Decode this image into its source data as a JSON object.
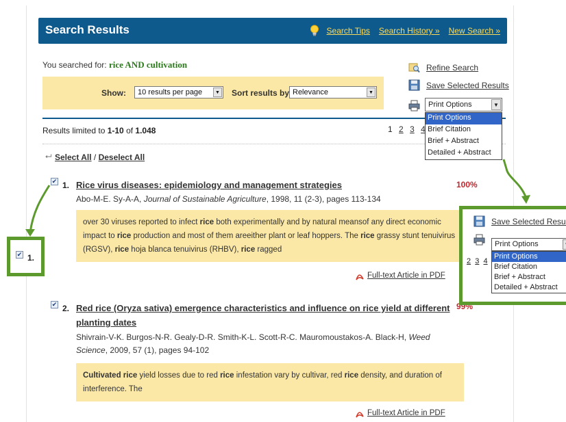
{
  "header": {
    "title": "Search Results",
    "links": [
      "Search Tips",
      "Search History »",
      "New Search »"
    ]
  },
  "query": {
    "prefix": "You searched for:",
    "term": "rice AND cultivation"
  },
  "controls": {
    "show_label": "Show:",
    "per_page_value": "10 results per page",
    "sort_label": "Sort results by:",
    "sort_value": "Relevance"
  },
  "side_actions": {
    "refine": "Refine Search",
    "save": "Save Selected Results",
    "print_value": "Print Options"
  },
  "print_options": [
    "Print Options",
    "Brief Citation",
    "Brief + Abstract",
    "Detailed + Abstract"
  ],
  "summary": {
    "prefix": "Results limited to ",
    "range": "1-10",
    "of": " of ",
    "total": "1.048"
  },
  "pager": [
    "1",
    "2",
    "3",
    "4"
  ],
  "select": {
    "select_all": "Select All",
    "sep": " / ",
    "deselect_all": "Deselect All"
  },
  "results": [
    {
      "num": "1.",
      "title": "Rice virus diseases: epidemiology and management strategies",
      "authors": "Abo-M-E. Sy-A-A, ",
      "journal": "Journal of Sustainable Agriculture",
      "citation": ", 1998, 11 (2-3), pages 113-134",
      "relevance": "100%",
      "snippet_html": "over 30 viruses reported to infect <b>rice</b> both experimentally and by natural meansof any direct economic impact to <b>rice</b> production and most of them areeither plant or leaf hoppers. The <b>rice</b> grassy stunt tenuivirus (RGSV), <b>rice</b> hoja blanca tenuivirus (RHBV), <b>rice</b> ragged",
      "pdf": "Full-text Article in PDF"
    },
    {
      "num": "2.",
      "title_line1": "Red rice (Oryza sativa) emergence characteristics and influence on rice yield at different",
      "title_line2": "planting dates",
      "authors": "Shivrain-V-K. Burgos-N-R. Gealy-D-R. Smith-K-L. Scott-R-C. Mauromoustakos-A. Black-H, ",
      "journal1": "Weed",
      "journal2": "Science",
      "citation": ", 2009, 57 (1), pages 94-102",
      "relevance": "99%",
      "snippet_html": "<b>Cultivated rice</b> yield losses due to red <b>rice</b> infestation vary by cultivar, red <b>rice</b> density, and duration of interference. The",
      "pdf": "Full-text Article in PDF"
    }
  ],
  "zoom_checkbox_label": "1.",
  "zoom_pager": [
    "2",
    "3",
    "4"
  ],
  "colors": {
    "header": "#0f5a8c",
    "highlight": "#fbe8a6",
    "annotation": "#5c9a2e",
    "relevance": "#c0282e"
  },
  "icons": [
    "lightbulb-icon",
    "refine-icon",
    "save-icon",
    "print-icon",
    "pdf-icon",
    "select-arrow-icon",
    "checkbox-icon"
  ]
}
